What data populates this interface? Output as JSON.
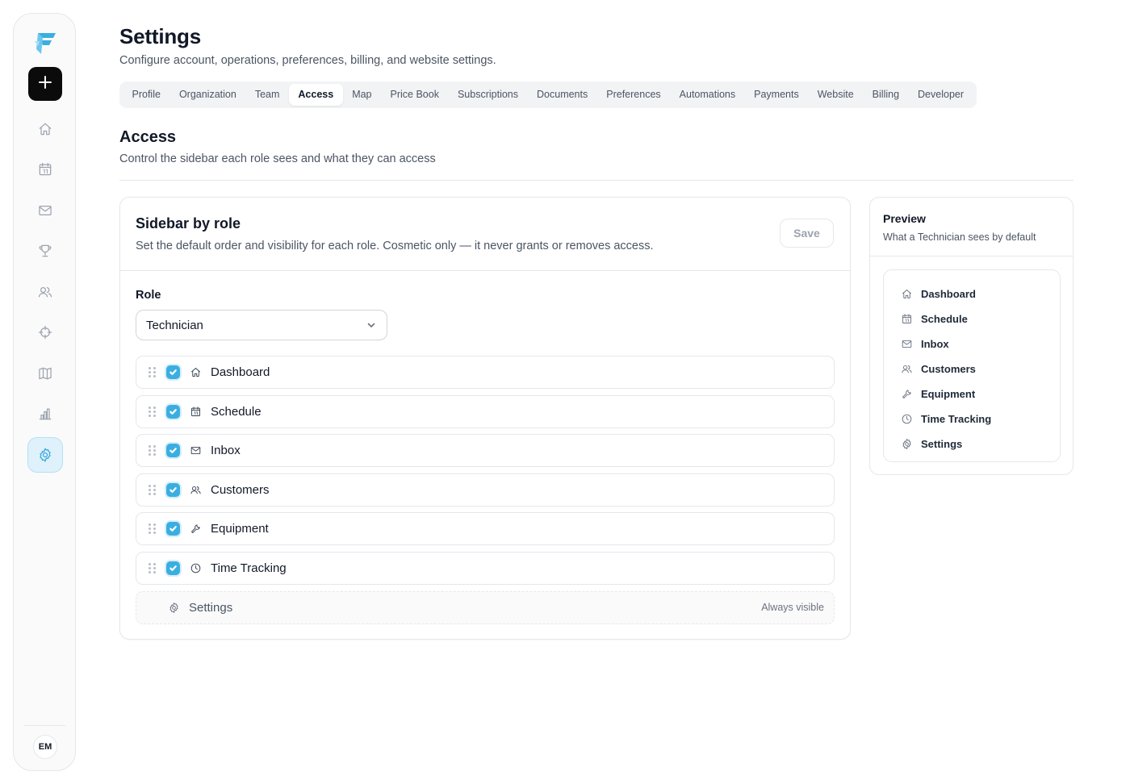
{
  "rail": {
    "brand": "brand-logo",
    "add_icon": "plus-icon",
    "items": [
      "home-icon",
      "calendar-icon",
      "mail-icon",
      "trophy-icon",
      "users-icon",
      "crosshair-icon",
      "map-icon",
      "bar-chart-icon",
      "gear-icon"
    ],
    "active_item": "gear-icon",
    "avatar_initials": "EM"
  },
  "header": {
    "title": "Settings",
    "subtitle": "Configure account, operations, preferences, billing, and website settings."
  },
  "tabs": [
    {
      "label": "Profile"
    },
    {
      "label": "Organization"
    },
    {
      "label": "Team"
    },
    {
      "label": "Access",
      "active": true
    },
    {
      "label": "Map"
    },
    {
      "label": "Price Book"
    },
    {
      "label": "Subscriptions"
    },
    {
      "label": "Documents"
    },
    {
      "label": "Preferences"
    },
    {
      "label": "Automations"
    },
    {
      "label": "Payments"
    },
    {
      "label": "Website"
    },
    {
      "label": "Billing"
    },
    {
      "label": "Developer"
    }
  ],
  "section": {
    "title": "Access",
    "subtitle": "Control the sidebar each role sees and what they can access"
  },
  "sidebar_by_role": {
    "title": "Sidebar by role",
    "subtitle": "Set the default order and visibility for each role. Cosmetic only — it never grants or removes access.",
    "save_label": "Save",
    "role_label": "Role",
    "role_value": "Technician",
    "items": [
      {
        "label": "Dashboard",
        "icon": "home-icon",
        "checked": true
      },
      {
        "label": "Schedule",
        "icon": "calendar-icon",
        "checked": true
      },
      {
        "label": "Inbox",
        "icon": "mail-icon",
        "checked": true
      },
      {
        "label": "Customers",
        "icon": "users-icon",
        "checked": true
      },
      {
        "label": "Equipment",
        "icon": "wrench-icon",
        "checked": true
      },
      {
        "label": "Time Tracking",
        "icon": "clock-icon",
        "checked": true
      }
    ],
    "locked_item": {
      "label": "Settings",
      "icon": "gear-icon",
      "note": "Always visible"
    }
  },
  "preview": {
    "title": "Preview",
    "subtitle": "What a Technician sees by default",
    "items": [
      {
        "label": "Dashboard",
        "icon": "home-icon"
      },
      {
        "label": "Schedule",
        "icon": "calendar-icon"
      },
      {
        "label": "Inbox",
        "icon": "mail-icon"
      },
      {
        "label": "Customers",
        "icon": "users-icon"
      },
      {
        "label": "Equipment",
        "icon": "wrench-icon"
      },
      {
        "label": "Time Tracking",
        "icon": "clock-icon"
      },
      {
        "label": "Settings",
        "icon": "gear-icon"
      }
    ]
  },
  "colors": {
    "accent": "#3aaee0",
    "active_nav_bg": "#dff1fb",
    "primary_button": "#0b0b0b"
  }
}
